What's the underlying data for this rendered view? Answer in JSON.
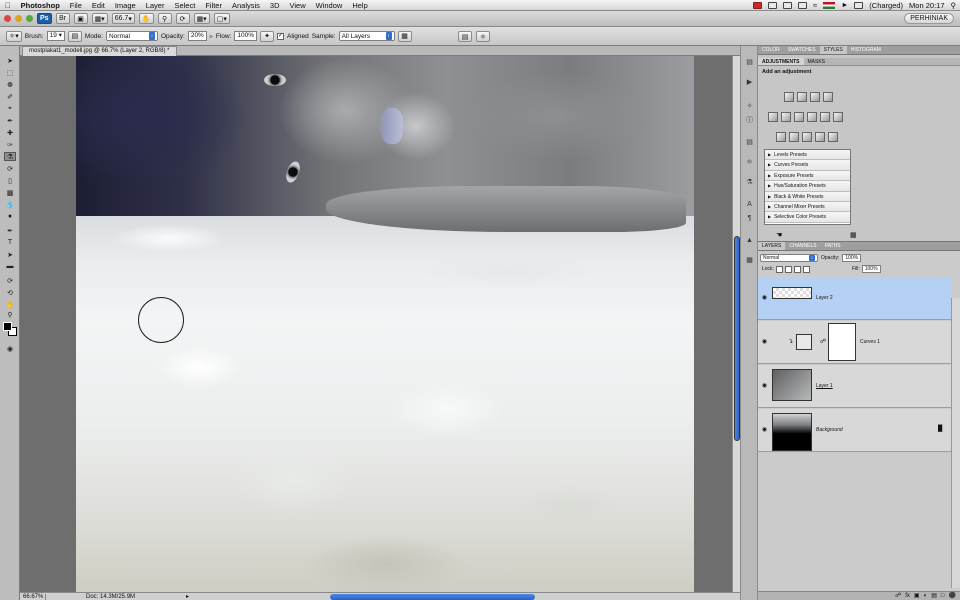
{
  "menubar": {
    "apple": "",
    "app": "Photoshop",
    "items": [
      "File",
      "Edit",
      "Image",
      "Layer",
      "Select",
      "Filter",
      "Analysis",
      "3D",
      "View",
      "Window",
      "Help"
    ],
    "battery": "(Charged)",
    "clock": "Mon 20:17"
  },
  "appbar": {
    "zoom": "66.7",
    "workspace": "PERHINIAK"
  },
  "options": {
    "brush_label": "Brush:",
    "brush_size": "19",
    "mode_label": "Mode:",
    "mode": "Normal",
    "opacity_label": "Opacity:",
    "opacity": "20%",
    "flow_label": "Flow:",
    "flow": "100%",
    "aligned_label": "Aligned",
    "aligned": true,
    "sample_label": "Sample:",
    "sample": "All Layers"
  },
  "document": {
    "tab_title": "mostplakat1_modell.jpg @ 66.7% (Layer 2, RGB/8) *"
  },
  "status": {
    "zoom": "66.67%",
    "doc_size": "Doc: 14.3M/25.9M"
  },
  "panels": {
    "top_tabs": [
      "COLOR",
      "SWATCHES",
      "STYLES",
      "HISTOGRAM"
    ],
    "active_top": "STYLES",
    "adj_tabs": [
      "ADJUSTMENTS",
      "MASKS"
    ],
    "adj_title": "Add an adjustment",
    "presets": [
      "Levels Presets",
      "Curves Presets",
      "Exposure Presets",
      "Hue/Saturation Presets",
      "Black & White Presets",
      "Channel Mixer Presets",
      "Selective Color Presets"
    ],
    "layer_tabs": [
      "LAYERS",
      "CHANNELS",
      "PATHS"
    ],
    "blend_mode": "Normal",
    "opacity_label": "Opacity:",
    "opacity": "100%",
    "lock_label": "Lock:",
    "fill_label": "Fill:",
    "fill": "100%",
    "layers": [
      {
        "name": "Layer 2",
        "selected": true
      },
      {
        "name": "Curves 1",
        "selected": false
      },
      {
        "name": "Layer 1",
        "selected": false
      },
      {
        "name": "Background",
        "selected": false
      }
    ]
  },
  "colors": {
    "selection": "#b5d0f5",
    "scroll_accent": "#2a61c5"
  }
}
